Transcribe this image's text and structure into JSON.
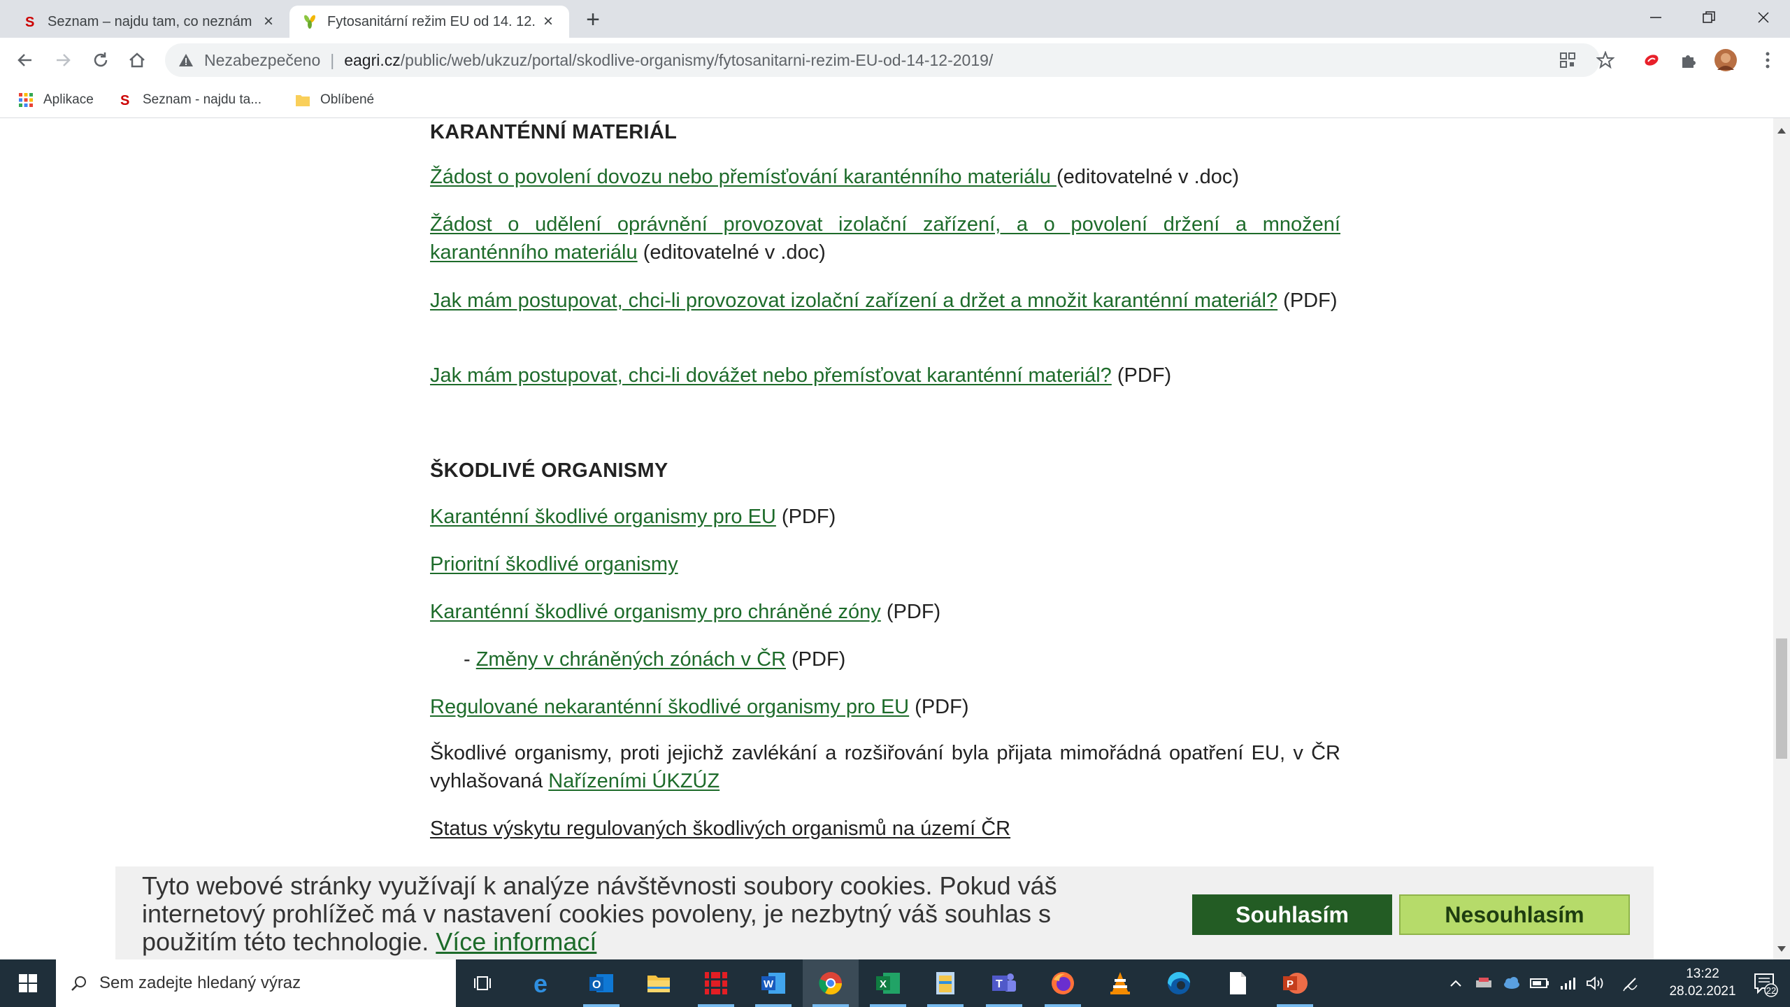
{
  "browser": {
    "tabs": [
      {
        "title": "Seznam – najdu tam, co neznám",
        "favicon": "seznam-s-icon",
        "active": false
      },
      {
        "title": "Fytosanitární režim EU od 14. 12.",
        "favicon": "eagri-leaf-icon",
        "active": true
      }
    ],
    "security_label": "Nezabezpečeno",
    "separator": "|",
    "url_host": "eagri.cz",
    "url_path": "/public/web/ukzuz/portal/skodlive-organismy/fytosanitarni-rezim-EU-od-14-12-2019/",
    "bookmarks": [
      {
        "label": "Aplikace",
        "icon": "apps-grid-icon"
      },
      {
        "label": "Seznam - najdu ta...",
        "icon": "seznam-s-icon"
      },
      {
        "label": "Oblíbené",
        "icon": "folder-icon"
      }
    ]
  },
  "page": {
    "section1_heading": "KARANTÉNNÍ MATERIÁL",
    "item1_link": "Žádost o povolení dovozu nebo přemísťování karanténního materiálu ",
    "item1_suffix": "(editovatelné v .doc)",
    "item2_link": "Žádost o udělení oprávnění provozovat izolační zařízení, a o povolení držení a množení karanténního materiálu",
    "item2_suffix": " (editovatelné v .doc)",
    "item3_link": "Jak mám postupovat, chci-li provozovat izolační zařízení a držet a množit karanténní materiál?",
    "item3_suffix": " (PDF)",
    "item4_link": "Jak mám postupovat, chci-li dovážet nebo přemísťovat karanténní materiál?",
    "item4_suffix": " (PDF)",
    "section2_heading": "ŠKODLIVÉ ORGANISMY",
    "org1_link": "Karanténní škodlivé organismy pro EU",
    "org1_suffix": " (PDF)",
    "org2_link": "Prioritní škodlivé organismy",
    "org3_link": "Karanténní škodlivé organismy pro chráněné zóny",
    "org3_suffix": " (PDF)",
    "org4_prefix": "- ",
    "org4_link": "Změny v chráněných zónách v ČR",
    "org4_suffix": " (PDF)",
    "org5_link": "Regulované nekaranténní škodlivé organismy pro EU",
    "org5_suffix": " (PDF)",
    "org6_text": "Škodlivé organismy, proti jejichž zavlékání a rozšiřování byla přijata mimořádná opatření EU, v ČR vyhlašovaná ",
    "org6_link": "Nařízeními ÚKZÚZ",
    "org7_link": "Status výskytu regulovaných škodlivých organismů na území ČR"
  },
  "cookie": {
    "message": "Tyto webové stránky využívají k analýze návštěvnosti soubory cookies. Pokud váš internetový prohlížeč má v nastavení cookies povoleny, je nezbytný váš souhlas s použitím této technologie. ",
    "more_link": "Více informací",
    "agree": "Souhlasím",
    "disagree": "Nesouhlasím"
  },
  "taskbar": {
    "search_placeholder": "Sem zadejte hledaný výraz",
    "apps": [
      "task-view",
      "edge-legacy",
      "outlook",
      "file-explorer",
      "red-app",
      "word",
      "chrome",
      "excel",
      "notepad-app",
      "teams",
      "firefox",
      "vlc",
      "edge",
      "file",
      "powerpoint"
    ],
    "time": "13:22",
    "date": "28.02.2021",
    "notifications": "22"
  },
  "colors": {
    "link": "#1d6b2a",
    "agree_bg": "#235c24",
    "disagree_bg": "#b6db6a",
    "taskbar": "#1f2f3a"
  }
}
